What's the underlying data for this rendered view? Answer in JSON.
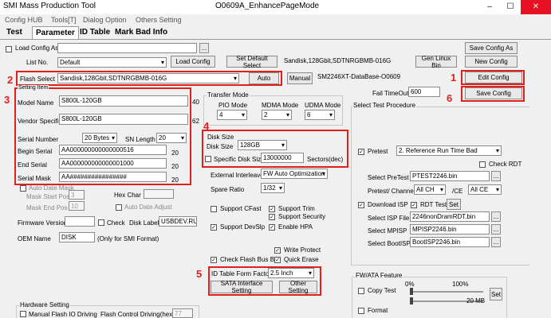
{
  "window": {
    "title": "SMI Mass Production Tool",
    "document": "O0609A_EnhancePageMode"
  },
  "menu": [
    "Config HUB",
    "Tools[T]",
    "Dialog Option",
    "Others Setting"
  ],
  "tabs": [
    "Test",
    "Parameter",
    "ID Table",
    "Mark Bad Info"
  ],
  "load_config_as": {
    "label": "Load Config As",
    "browse": "..."
  },
  "list_no": {
    "label": "List No.",
    "value": "Default"
  },
  "buttons": {
    "load_config": "Load Config",
    "set_default_select": "Set Default Select",
    "gen_linux_bin": "Gen Linux Bin",
    "save_config_as": "Save Config As",
    "new_config": "New Config",
    "edit_config": "Edit Config",
    "save_config": "Save Config",
    "auto": "Auto",
    "manual": "Manual",
    "sata_interface_setting": "SATA Interface Setting",
    "other_setting": "Other Setting",
    "set": "Set",
    "browse": "..."
  },
  "flash_info": "Sandisk,128Gbit,SDTNRGBMB-016G",
  "database": "SM2246XT-DataBase-O0609",
  "flash_select": {
    "label": "Flash Select",
    "value": "Sandisk,128Gbit,SDTNRGBMB-016G"
  },
  "fail_timeout": {
    "label": "Fail TimeOut",
    "value": "600"
  },
  "setting_item": {
    "title": "Setting Item",
    "model_name": {
      "label": "Model Name",
      "value": "S800L-120GB",
      "len": "40"
    },
    "vendor_specific": {
      "label": "Vendor Specific",
      "value": "S800L-120GB",
      "len": "62"
    },
    "serial_number": {
      "label": "Serial Number",
      "value": "20 Bytes"
    },
    "sn_length": {
      "label": "SN Length",
      "value": "20"
    },
    "begin_serial": {
      "label": "Begin Serial",
      "value": "AA000000000000000516",
      "len": "20"
    },
    "end_serial": {
      "label": "End Serial",
      "value": "AA000000000000001000",
      "len": "20"
    },
    "serial_mask": {
      "label": "Serial Mask",
      "value": "AA################",
      "len": "20"
    },
    "auto_date_mask": "Auto Date Mask",
    "mask_start_pos": {
      "label": "Mask Start Pos",
      "value": "3"
    },
    "mask_end_pos": {
      "label": "Mask End Pos",
      "value": "10"
    },
    "hex_char": "Hex Char",
    "auto_date_adjust": "Auto Date Adjust"
  },
  "firmware_version": {
    "label": "Firmware Version",
    "check": "Check",
    "value": ""
  },
  "disk_label": {
    "label": "Disk Label",
    "value": "USBDEV.RU"
  },
  "oem_name": {
    "label": "OEM Name",
    "value": "DISK",
    "note": "(Only for SMI Format)"
  },
  "hardware_setting": {
    "title": "Hardware Setting",
    "manual_flash_io": "Manual Flash IO Driving",
    "flash_control_driving": "Flash Control Driving(hex)",
    "flash_control_value": "77"
  },
  "transfer_mode": {
    "title": "Transfer Mode",
    "pio": {
      "label": "PIO Mode",
      "value": "4"
    },
    "mdma": {
      "label": "MDMA Mode",
      "value": "2"
    },
    "udma": {
      "label": "UDMA Mode",
      "value": "6"
    }
  },
  "disk_size": {
    "title": "Disk Size",
    "label": "Disk Size",
    "value": "128GB",
    "specific_label": "Specific Disk Size",
    "specific_value": "13000000",
    "unit": "Sectors(dec)"
  },
  "external_interleave": {
    "label": "External Interleave",
    "value": "FW Auto Optimization"
  },
  "spare_ratio": {
    "label": "Spare Ratio",
    "value": "1/32"
  },
  "options": {
    "support_cfast": "Support CFast",
    "support_trim": "Support Trim",
    "support_security": "Support Security",
    "support_devslp": "Support DevSlp",
    "enable_hpa": "Enable HPA",
    "write_protect": "Write Protect",
    "check_flash_bus_bit": "Check Flash Bus Bit",
    "quick_erase": "Quick Erase"
  },
  "id_table_form_factor": {
    "label": "ID Table Form Factor",
    "value": "2.5 Inch"
  },
  "select_test_procedure": {
    "title": "Select Test Procedure",
    "pretest": {
      "label": "Pretest",
      "value": "2. Reference Run Time Bad"
    },
    "check_rdt": "Check RDT",
    "select_pretest": {
      "label": "Select PreTest",
      "value": "PTEST2246.bin"
    },
    "pretest_channel": {
      "label": "Pretest/ Channel",
      "value": "All CH"
    },
    "ce_label": "/CE",
    "ce_value": "All CE",
    "download_isp": "Download ISP",
    "rdt_test": "RDT Test",
    "select_isp": {
      "label": "Select ISP File",
      "value": "2246nonDramRDT.bin"
    },
    "select_mpisp": {
      "label": "Select MPISP",
      "value": "MPISP2246.bin"
    },
    "select_bootisp": {
      "label": "Select BootISP",
      "value": "BootISP2246.bin"
    }
  },
  "fw_ata": {
    "title": "FW/ATA Feature",
    "copy_test": "Copy Test",
    "pct_0": "0%",
    "pct_100": "100%",
    "size": "20 MB",
    "format": "Format"
  },
  "markers": [
    "1",
    "2",
    "3",
    "4",
    "5",
    "6"
  ],
  "colors": {
    "annotation": "#e0201a",
    "close": "#e81123"
  }
}
